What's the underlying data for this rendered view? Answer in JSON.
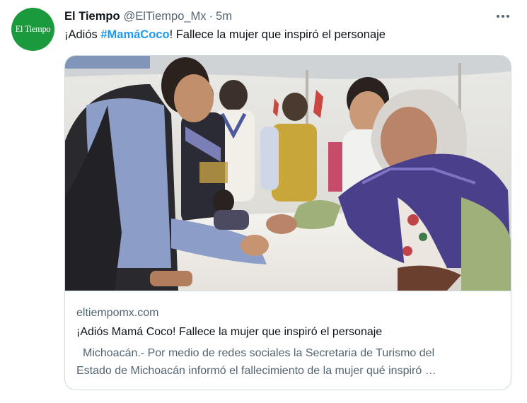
{
  "author": {
    "avatar_text": "El Tiempo",
    "display_name": "El Tiempo",
    "handle": "@ElTiempo_Mx",
    "separator": "·",
    "time": "5m"
  },
  "tweet": {
    "text_before": "¡Adiós ",
    "hashtag": "#MamáCoco",
    "text_after": "! Fallece la mujer que inspiró el personaje"
  },
  "card": {
    "domain": "eltiempomx.com",
    "title": "¡Adiós Mamá Coco! Fallece la mujer que inspiró el personaje",
    "description_line1": "Michoacán.- Por medio de redes sociales la Secretaria de Turismo del",
    "description_line2": "Estado de Michoacán informó el fallecimiento de la mujer qué inspiró …"
  },
  "icons": {
    "more": "more-horizontal-icon"
  },
  "colors": {
    "avatar_bg": "#1a9a3c",
    "hashtag": "#1d9bf0",
    "secondary_text": "#536471",
    "border": "#cfd9de"
  }
}
